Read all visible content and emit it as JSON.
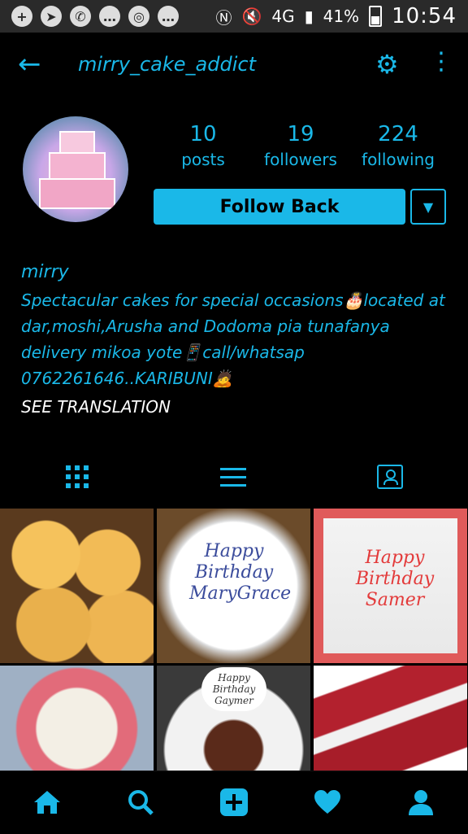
{
  "status_bar": {
    "battery": "41%",
    "network": "4G",
    "time": "10:54",
    "left_icons": [
      "add-icon",
      "telegram-icon",
      "whatsapp-icon",
      "message-icon",
      "instagram-icon",
      "message-icon"
    ]
  },
  "header": {
    "username": "mirry_cake_addict",
    "back_icon": "arrow-left-icon",
    "settings_icon": "gear-icon",
    "more_icon": "more-vertical-icon"
  },
  "profile": {
    "stats": [
      {
        "num": "10",
        "label": "posts"
      },
      {
        "num": "19",
        "label": "followers"
      },
      {
        "num": "224",
        "label": "following"
      }
    ],
    "follow_label": "Follow Back"
  },
  "bio": {
    "name": "mirry",
    "text": "Spectacular cakes for special occasions🎂located at dar,moshi,Arusha and Dodoma pia tunafanya delivery mikoa yote📱call/whatsap 0762261646..KARIBUNI🙇",
    "see_translation": "SEE TRANSLATION"
  },
  "tabs": [
    "grid-icon",
    "list-icon",
    "tagged-icon"
  ],
  "photos": [
    {
      "label": ""
    },
    {
      "label": "Happy Birthday MaryGrace"
    },
    {
      "label": "Happy Birthday Samer"
    },
    {
      "label": ""
    },
    {
      "label": "Happy Birthday Gaymer"
    },
    {
      "label": ""
    }
  ],
  "bottom_nav": [
    "home-icon",
    "search-icon",
    "add-icon",
    "heart-icon",
    "profile-icon"
  ],
  "colors": {
    "accent": "#1ab8e8",
    "background": "#000000"
  }
}
